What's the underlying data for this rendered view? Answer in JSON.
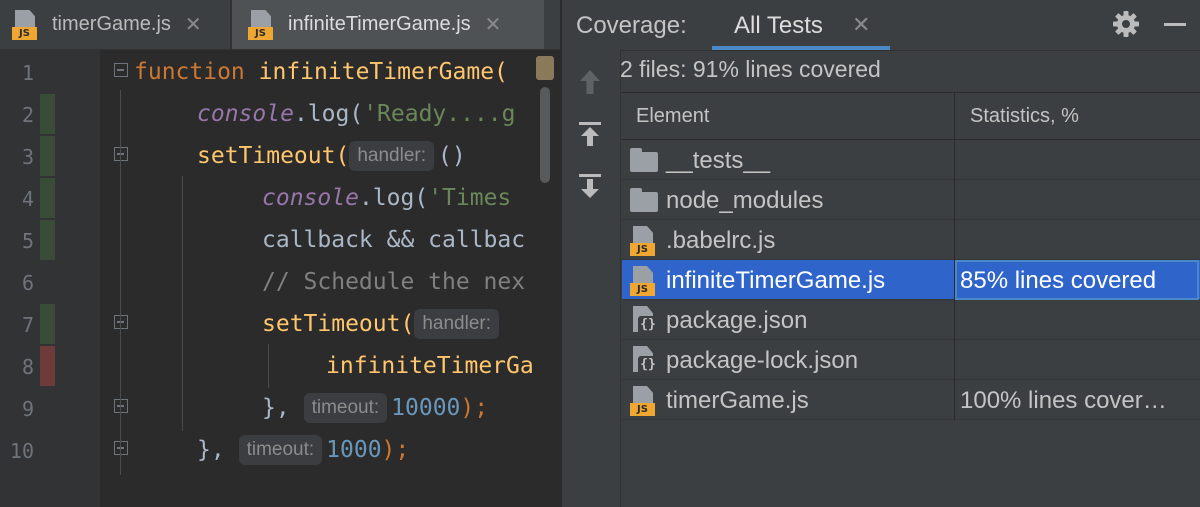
{
  "editor": {
    "tabs": [
      {
        "label": "timerGame.js",
        "icon": "js-file-icon",
        "active": false
      },
      {
        "label": "infiniteTimerGame.js",
        "icon": "js-file-icon",
        "active": true
      }
    ],
    "file_badge": "JS",
    "line_numbers": [
      "1",
      "2",
      "3",
      "4",
      "5",
      "6",
      "7",
      "8",
      "9",
      "10"
    ],
    "code": {
      "l1_kw": "function",
      "l1_fn": "infiniteTimerGame(",
      "l2_obj": "console",
      "l2_mid": ".log(",
      "l2_str": "'Ready....g",
      "l3_fn": "setTimeout(",
      "l3_hint": "handler:",
      "l3_rest": "()",
      "l4_obj": "console",
      "l4_mid": ".log(",
      "l4_str": "'Times",
      "l5_text": "callback && callbac",
      "l6_cmt": "// Schedule the nex",
      "l7_fn": "setTimeout(",
      "l7_hint": "handler:",
      "l8_fn": "infiniteTimerGa",
      "l9_pre": "},",
      "l9_hint": "timeout:",
      "l9_num": "10000",
      "l9_post": ");",
      "l10_pre": "},",
      "l10_hint": "timeout:",
      "l10_num": "1000",
      "l10_post": ");"
    },
    "coverage_marks": {
      "covered_color": "#384c38",
      "uncovered_color": "#6e3b3b"
    }
  },
  "coverage_panel": {
    "title": "Coverage:",
    "tab": "All Tests",
    "summary": "2 files: 91% lines covered",
    "columns": {
      "element": "Element",
      "statistics": "Statistics, %"
    },
    "rows": [
      {
        "name": "__tests__",
        "type": "folder",
        "stat": ""
      },
      {
        "name": "node_modules",
        "type": "folder",
        "stat": ""
      },
      {
        "name": ".babelrc.js",
        "type": "js",
        "stat": ""
      },
      {
        "name": "infiniteTimerGame.js",
        "type": "js",
        "stat": "85% lines covered",
        "selected": true
      },
      {
        "name": "package.json",
        "type": "json",
        "stat": ""
      },
      {
        "name": "package-lock.json",
        "type": "json",
        "stat": ""
      },
      {
        "name": "timerGame.js",
        "type": "js",
        "stat": "100% lines cover…"
      }
    ],
    "toolbar_icons": [
      "run-up-icon",
      "export-icon",
      "import-icon"
    ]
  },
  "colors": {
    "accent": "#4a88c7",
    "selection": "#2f65ca",
    "js_badge": "#f0a732"
  }
}
